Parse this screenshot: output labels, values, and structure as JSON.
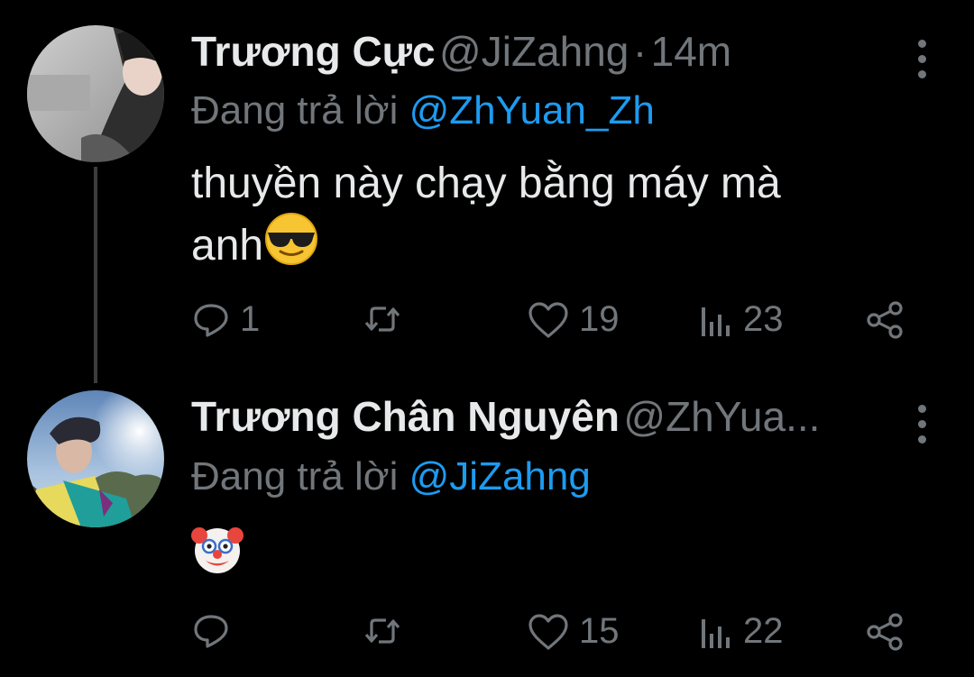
{
  "tweets": [
    {
      "name": "Trương Cực",
      "handle": "@JiZahng",
      "separator": "·",
      "time": "14m",
      "replying_prefix": "Đang trả lời",
      "replying_to": "@ZhYuan_Zh",
      "text_line1": "thuyền này chạy bằng máy mà",
      "text_line2": "anh",
      "emoji": "smiling-face-with-sunglasses",
      "reply_count": "1",
      "retweet_count": "",
      "like_count": "19",
      "view_count": "23"
    },
    {
      "name": "Trương Chân Nguyên",
      "handle": "@ZhYua...",
      "replying_prefix": "Đang trả lời",
      "replying_to": "@JiZahng",
      "emoji": "clown-face",
      "reply_count": "",
      "retweet_count": "",
      "like_count": "15",
      "view_count": "22"
    }
  ],
  "colors": {
    "background": "#000000",
    "text": "#e7e9ea",
    "muted": "#71767b",
    "accent": "#1d9bf0"
  }
}
